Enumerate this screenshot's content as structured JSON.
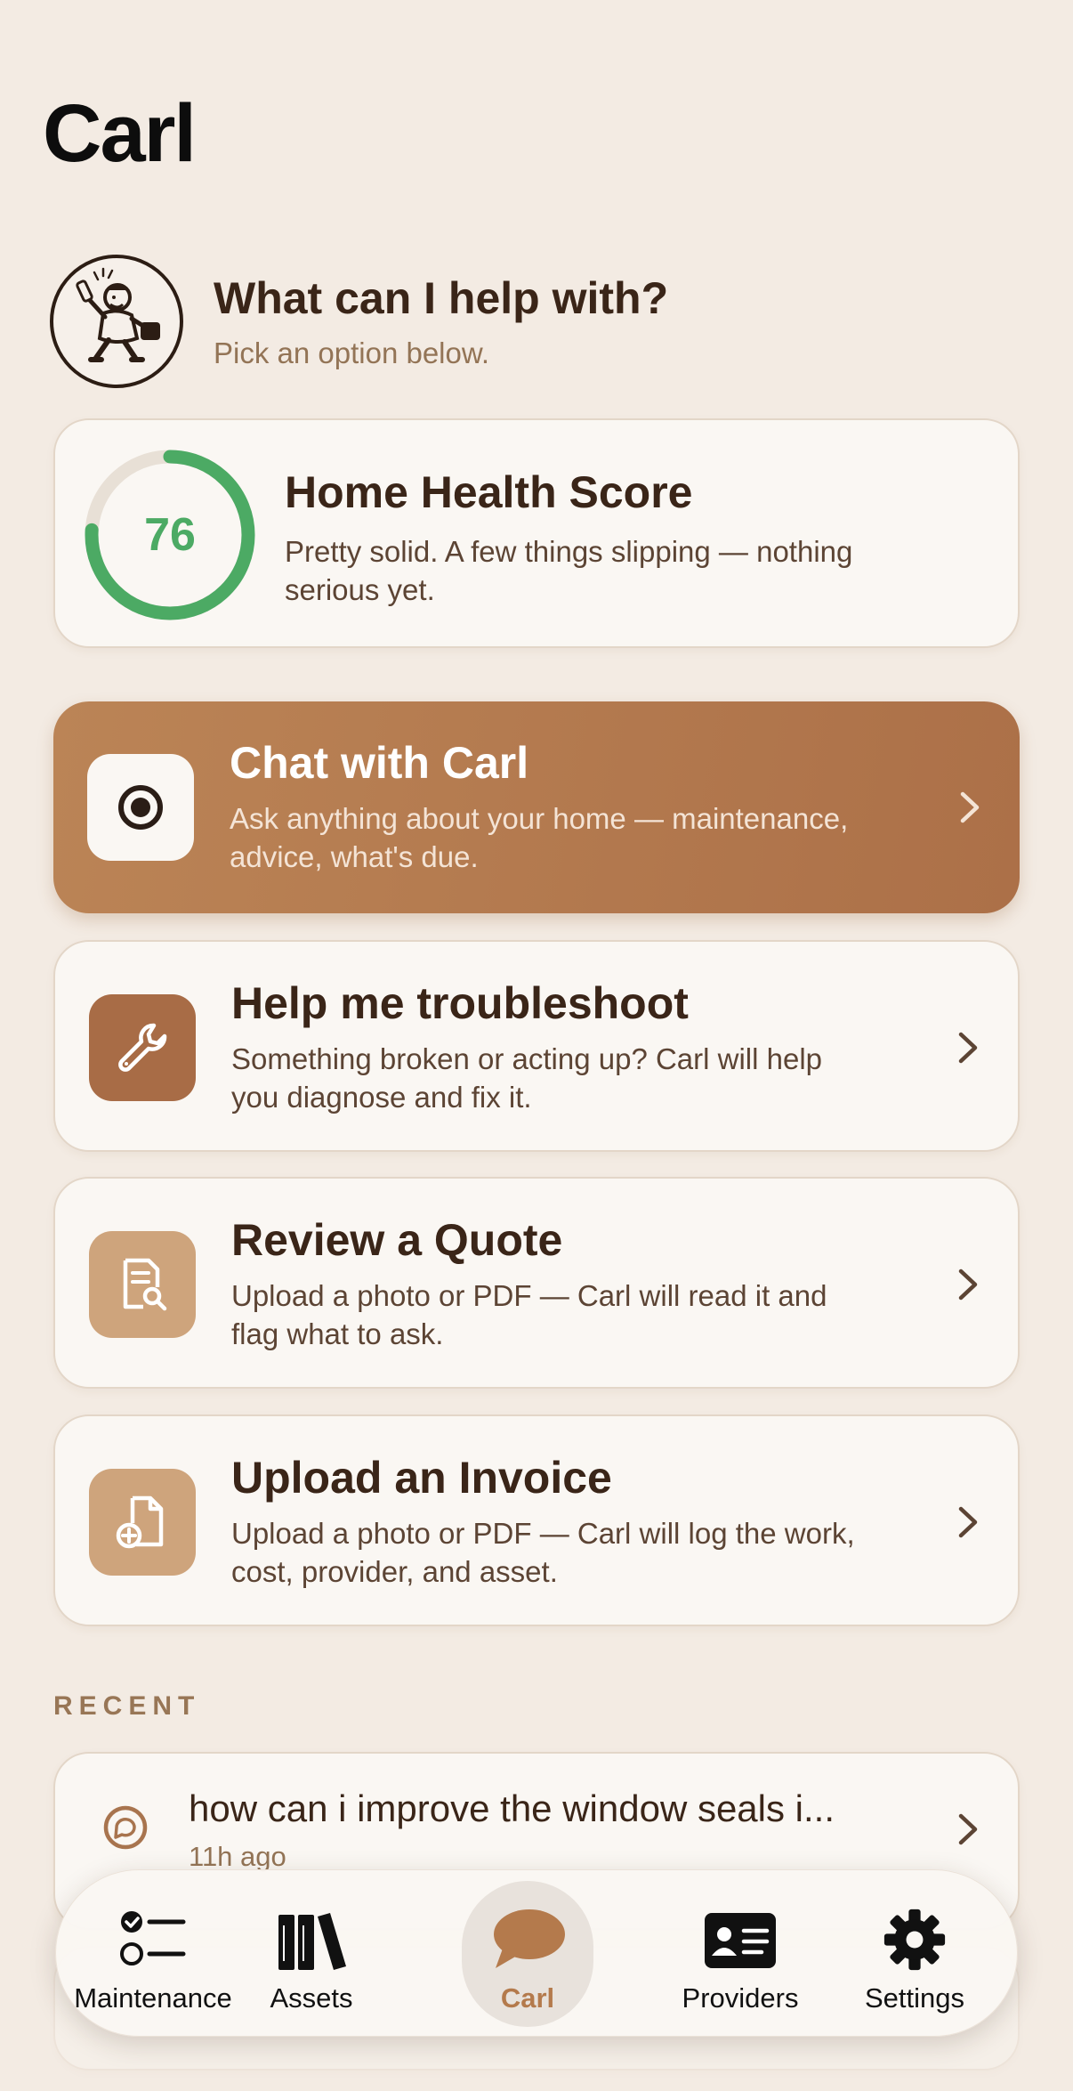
{
  "page": {
    "title": "Carl"
  },
  "intro": {
    "title": "What can I help with?",
    "subtitle": "Pick an option below."
  },
  "health": {
    "score": 76,
    "score_fraction": 0.76,
    "title": "Home Health Score",
    "description": "Pretty solid. A few things slipping — nothing serious yet.",
    "ring_color": "#4caa64"
  },
  "options": [
    {
      "title": "Chat with Carl",
      "description": "Ask anything about your home — maintenance, advice, what's due.",
      "icon": "chat-bubble-icon"
    },
    {
      "title": "Help me troubleshoot",
      "description": "Something broken or acting up? Carl will help you diagnose and fix it.",
      "icon": "wrench-icon"
    },
    {
      "title": "Review a Quote",
      "description": "Upload a photo or PDF — Carl will read it and flag what to ask.",
      "icon": "document-search-icon"
    },
    {
      "title": "Upload an Invoice",
      "description": "Upload a photo or PDF — Carl will log the work, cost, provider, and asset.",
      "icon": "document-add-icon"
    }
  ],
  "recent": {
    "label": "RECENT",
    "items": [
      {
        "title": "how can i improve the window seals i...",
        "time": "11h ago"
      }
    ]
  },
  "tabs": [
    {
      "label": "Maintenance",
      "icon": "checklist-icon",
      "active": false
    },
    {
      "label": "Assets",
      "icon": "books-icon",
      "active": false
    },
    {
      "label": "Carl",
      "icon": "chat-bubble-icon",
      "active": true
    },
    {
      "label": "Providers",
      "icon": "id-card-icon",
      "active": false
    },
    {
      "label": "Settings",
      "icon": "gear-icon",
      "active": false
    }
  ],
  "colors": {
    "background": "#f3ebe3",
    "accent": "#b47a4c",
    "card": "#faf7f3",
    "health_green": "#4caa64"
  }
}
